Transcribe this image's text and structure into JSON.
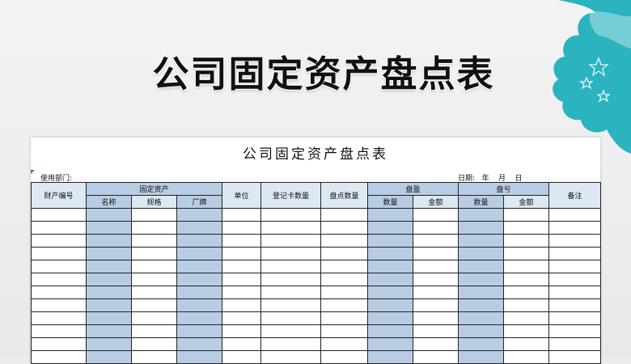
{
  "banner": {
    "title": "公司固定资产盘点表"
  },
  "sheet": {
    "title": "公司固定资产盘点表",
    "dept_label": "使用部门:",
    "date_label": "日期:   年    月    日"
  },
  "table": {
    "headers": {
      "asset_no": "财产编号",
      "fixed_asset": "固定资产",
      "name": "名称",
      "spec": "规格",
      "maker": "厂牌",
      "unit": "单位",
      "card_qty": "登记卡数量",
      "count_qty": "盘点数量",
      "surplus": "盘盈",
      "surplus_qty": "数量",
      "surplus_amt": "金额",
      "loss": "盘亏",
      "loss_qty": "数量",
      "loss_amt": "金额",
      "remarks": "备注"
    },
    "empty_row_count": 12
  },
  "colors": {
    "accent_cloud": "#2bb3c0",
    "header_fill": "#b8cde3"
  }
}
